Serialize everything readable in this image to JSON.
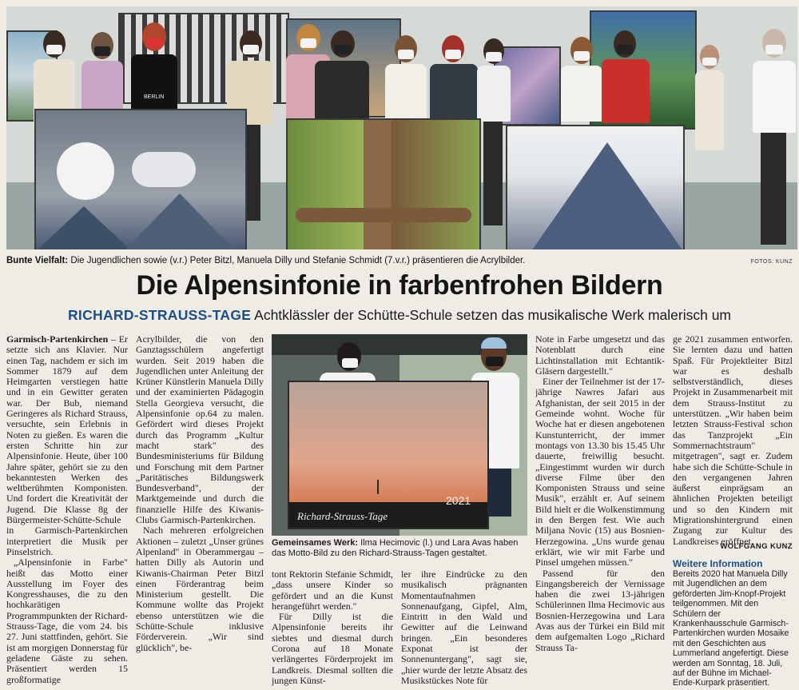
{
  "top_photo": {
    "caption_lead": "Bunte Vielfalt:",
    "caption_text": "Die Jugendlichen sowie (v.r.) Peter Bitzl, Manuela Dilly und Stefanie Schmidt (7.v.r.) präsentieren die Acrylbilder.",
    "credit": "FOTOS: KUNZ",
    "shirt_text": "BERLIN"
  },
  "headline": "Die Alpensinfonie in farbenfrohen Bildern",
  "subhead": {
    "kicker": "RICHARD-STRAUSS-TAGE",
    "text": "Achtklässler der Schütte-Schule setzen das musikalische Werk malerisch um"
  },
  "mid_photo": {
    "canvas_label": "Richard-Strauss-Tage",
    "canvas_year": "2021",
    "caption_lead": "Gemeinsames Werk:",
    "caption_text": "Ilma Hecimovic (l.) und Lara Avas haben das Motto-Bild zu den Richard-Strauss-Tagen gestaltet."
  },
  "article": {
    "dateline": "Garmisch-Partenkirchen",
    "col1_p1": "– Er setzte sich ans Klavier. Nur einen Tag, nachdem er sich im Sommer 1879 auf dem Heimgarten verstiegen hatte und in ein Gewitter geraten war. Der Bub, niemand Geringeres als Richard Strauss, versuchte, sein Erlebnis in Noten zu gießen. Es waren die ersten Schritte hin zur Alpensinfonie. Heute, über 100 Jahre später, gehört sie zu den bekanntesten Werken des weltberühmten Komponisten. Und fordert die Kreativität der Jugend. Die Klasse 8g der Bürgermeister-Schütte-Schule in Garmisch-Partenkirchen interpretiert die Musik per Pinselstrich.",
    "col1_p2": "„Alpensinfonie in Farbe\" heißt das Motto einer Ausstellung im Foyer des Kongresshauses, die zu den hochkarätigen Programmpunkten der Richard-Strauss-Tage, die vom 24. bis 27. Juni stattfinden, gehört. Sie ist am morgigen Donnerstag für geladene Gäste zu sehen. Präsentiert werden 15 großformatige",
    "col2_p1": "Acrylbilder, die von den Ganztagsschülern angefertigt wurden. Seit 2019 haben die Jugendlichen unter Anleitung der Krüner Künstlerin Manuela Dilly und der examinierten Pädagogin Stella Georgieva versucht, die Alpensinfonie op.64 zu malen. Gefördert wird dieses Projekt durch das Programm „Kultur macht stark\" des Bundesministeriums für Bildung und Forschung mit dem Partner „Paritätisches Bildungswerk Bundesverband\", der Marktgemeinde und durch die finanzielle Hilfe des Kiwanis-Clubs Garmisch-Partenkirchen.",
    "col2_p2": "Nach mehreren erfolgreichen Aktionen – zuletzt „Unser grünes Alpenland\" in Oberammergau – hatten Dilly als Autorin und Kiwanis-Chairman Peter Bitzl einen Förderantrag beim Ministerium gestellt. Die Kommune wollte das Projekt ebenso unterstützen wie die Schütte-Schule inklusive Förderverein. „Wir sind glücklich\", be-",
    "col3a_p1": "tont Rektorin Stefanie Schmidt, „dass unsere Kinder so gefördert und an die Kunst herangeführt werden.\"",
    "col3a_p2": "Für Dilly ist die Alpensinfonie bereits ihr siebtes und diesmal durch Corona auf 18 Monate verlängertes Förderprojekt im Landkreis. Diesmal sollten die jungen Künst-",
    "col4a_p1": "ler ihre Eindrücke zu den musikalisch prägnanten Momentaufnahmen Sonnenaufgang, Gipfel, Alm, Eintritt in den Wald und Gewitter auf die Leinwand bringen. „Ein besonderes Exponat ist der Sonnenuntergang\", sagt sie, „hier wurde der letzte Absatz des Musikstückes Note für",
    "col4_p1": "Note in Farbe umgesetzt und das Notenblatt durch eine Lichtinstallation mit Echtantik-Gläsern dargestellt.\"",
    "col4_p2": "Einer der Teilnehmer ist der 17-jährige Nawres Jafari aus Afghanistan, der seit 2015 in der Gemeinde wohnt. Woche für Woche hat er diesen angebotenen Kunstunterricht, der immer montags von 13.30 bis 15.45 Uhr dauerte, freiwillig besucht. „Eingestimmt wurden wir durch diverse Filme über den Komponisten Strauss und seine Musik\", erzählt er. Auf seinem Bild hielt er die Wolkenstimmung in den Bergen fest. Wie auch Miljana Novic (15) aus Bosnien-Herzegowina. „Uns wurde genau erklärt, wie wir mit Farbe und Pinsel umgehen müssen.\"",
    "col4_p3": "Passend für den Eingangsbereich der Vernissage haben die zwei 13-jährigen Schülerinnen Ilma Hecimovic aus Bosnien-Herzegowina und Lara Avas aus der Türkei ein Bild mit dem aufgemalten Logo „Richard Strauss Ta-",
    "col5_p1": "ge 2021 zusammen entworfen. Sie lernten dazu und hatten Spaß. Für Projektleiter Bitzl war es deshalb selbstverständlich, dieses Projekt in Zusammenarbeit mit dem Strauss-Institut zu unterstützen. „Wir haben beim letzten Strauss-Festival schon das Tanzprojekt „Ein Sommernachtstraum\" mitgetragen\", sagt er. Zudem habe sich die Schütte-Schule in den vergangenen Jahren äußerst einprägsam an ähnlichen Projekten beteiligt und so den Kindern mit Migrationshintergrund einen Zugang zur Kultur des Landkreises eröffnet.",
    "author": "WOLFGANG KUNZ"
  },
  "info_box": {
    "title": "Weitere Information",
    "text": "Bereits 2020 hat Manuela Dilly mit Jugendlichen an dem geförderten Jim-Knopf-Projekt teilgenommen. Mit den Schülern der Krankenhausschule Garmisch-Partenkirchen wurden Mosaike mit den Geschichten aus Lummerland angefertigt. Diese werden am Sonntag, 18. Juli, auf der Bühne im Michael-Ende-Kurpark präsentiert."
  },
  "colors": {
    "accent": "#1d4f86",
    "paper": "#efece6"
  }
}
